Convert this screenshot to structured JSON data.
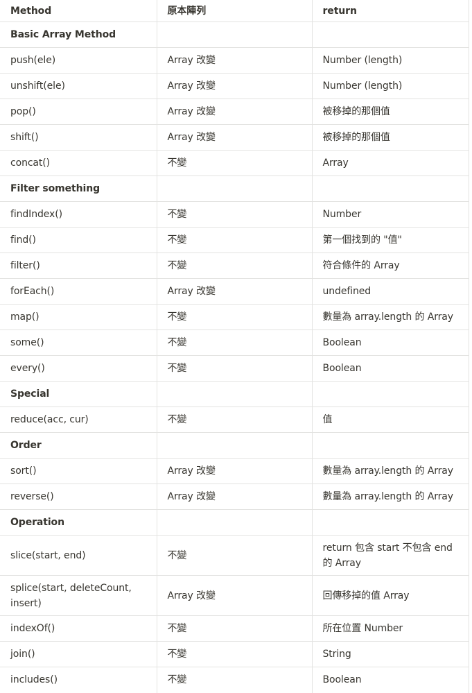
{
  "headers": [
    "Method",
    "原本陣列",
    "return"
  ],
  "rows": [
    {
      "type": "section",
      "cells": [
        "Basic Array Method",
        "",
        ""
      ]
    },
    {
      "type": "row",
      "cells": [
        "push(ele)",
        "Array 改變",
        "Number (length)"
      ]
    },
    {
      "type": "row",
      "cells": [
        "unshift(ele)",
        "Array 改變",
        "Number (length)"
      ]
    },
    {
      "type": "row",
      "cells": [
        "pop()",
        "Array 改變",
        "被移掉的那個值"
      ]
    },
    {
      "type": "row",
      "cells": [
        "shift()",
        "Array 改變",
        "被移掉的那個值"
      ]
    },
    {
      "type": "row",
      "cells": [
        "concat()",
        "不變",
        "Array"
      ]
    },
    {
      "type": "section",
      "cells": [
        "Filter something",
        "",
        ""
      ]
    },
    {
      "type": "row",
      "cells": [
        "findIndex()",
        "不變",
        "Number"
      ]
    },
    {
      "type": "row",
      "cells": [
        "find()",
        "不變",
        "第一個找到的 \"值\""
      ]
    },
    {
      "type": "row",
      "cells": [
        "filter()",
        "不變",
        "符合條件的 Array"
      ]
    },
    {
      "type": "row",
      "cells": [
        "forEach()",
        "Array 改變",
        "undefined"
      ]
    },
    {
      "type": "row",
      "cells": [
        "map()",
        "不變",
        "數量為 array.length 的 Array"
      ]
    },
    {
      "type": "row",
      "cells": [
        "some()",
        "不變",
        "Boolean"
      ]
    },
    {
      "type": "row",
      "cells": [
        "every()",
        "不變",
        "Boolean"
      ]
    },
    {
      "type": "section",
      "cells": [
        "Special",
        "",
        ""
      ]
    },
    {
      "type": "row",
      "cells": [
        "reduce(acc, cur)",
        "不變",
        "值"
      ]
    },
    {
      "type": "section",
      "cells": [
        "Order",
        "",
        ""
      ]
    },
    {
      "type": "row",
      "cells": [
        "sort()",
        "Array 改變",
        "數量為 array.length 的 Array"
      ]
    },
    {
      "type": "row",
      "cells": [
        "reverse()",
        "Array 改變",
        "數量為 array.length 的 Array"
      ]
    },
    {
      "type": "section",
      "cells": [
        "Operation",
        "",
        ""
      ]
    },
    {
      "type": "row",
      "tall": true,
      "cells": [
        "slice(start, end)",
        "不變",
        "return 包含 start 不包含 end 的 Array"
      ]
    },
    {
      "type": "row",
      "tall": true,
      "cells": [
        "splice(start, deleteCount, insert)",
        "Array 改變",
        "回傳移掉的值 Array"
      ]
    },
    {
      "type": "row",
      "cells": [
        "indexOf()",
        "不變",
        "所在位置 Number"
      ]
    },
    {
      "type": "row",
      "cells": [
        "join()",
        "不變",
        "String"
      ]
    },
    {
      "type": "row",
      "last": true,
      "cells": [
        "includes()",
        "不變",
        "Boolean"
      ]
    }
  ]
}
